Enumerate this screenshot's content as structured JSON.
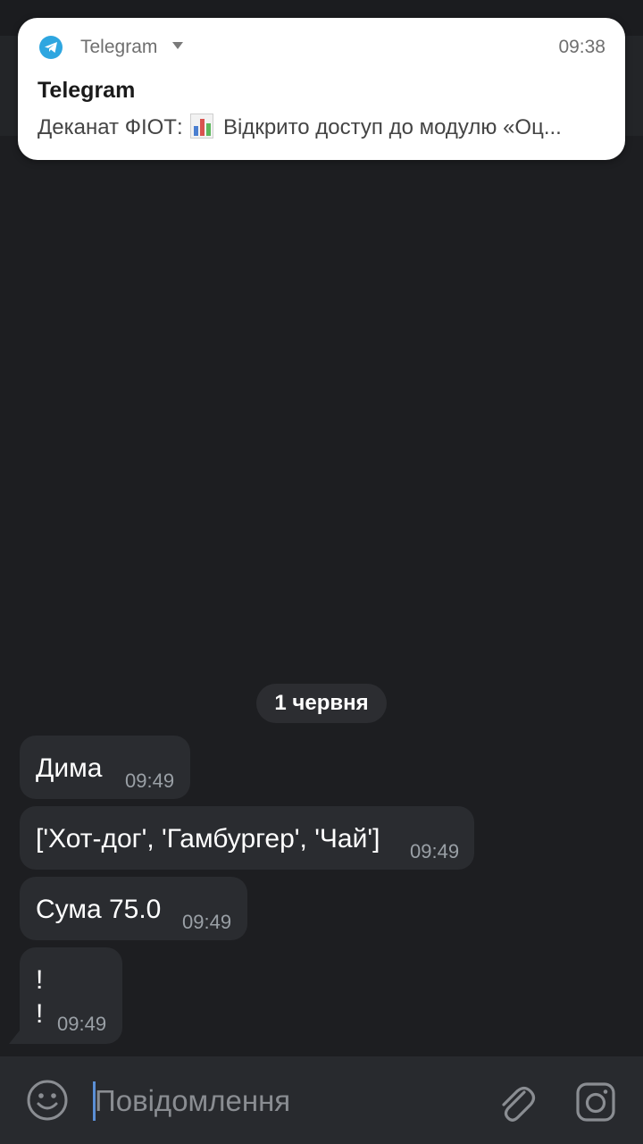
{
  "notification": {
    "app_name": "Telegram",
    "time": "09:38",
    "title": "Telegram",
    "body_prefix": "Деканат ФІОТ:",
    "body_suffix": "Відкрито доступ до модулю «Оц...",
    "app_icon": "telegram-icon",
    "emoji_icon": "bar-chart-emoji"
  },
  "chat": {
    "date_label": "1 червня",
    "messages": [
      {
        "text": "Дима",
        "time": "09:49"
      },
      {
        "text": "['Хот-дог', 'Гамбургер', 'Чай']",
        "time": "09:49"
      },
      {
        "text": "Сума 75.0",
        "time": "09:49"
      },
      {
        "line1": "!",
        "line2": "!",
        "time": "09:49"
      }
    ]
  },
  "input": {
    "placeholder": "Повідомлення",
    "icons": [
      "smile-icon",
      "paperclip-icon",
      "camera-icon"
    ]
  },
  "colors": {
    "background": "#1d1e21",
    "bubble": "#2a2c30",
    "telegram_blue": "#2ea6e0",
    "cursor": "#5b8fd6"
  }
}
